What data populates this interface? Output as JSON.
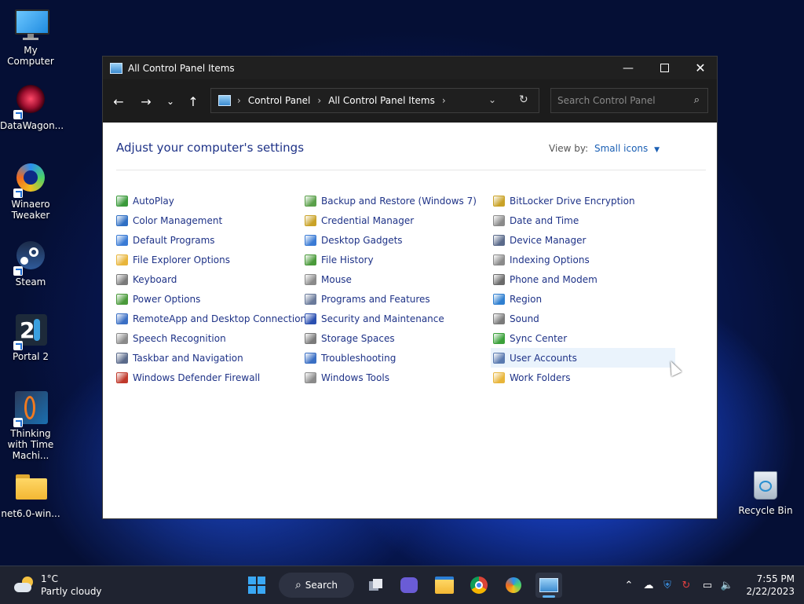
{
  "desktop": {
    "icons": [
      {
        "label": "My Computer"
      },
      {
        "label": "DataWagon..."
      },
      {
        "label": "Winaero Tweaker"
      },
      {
        "label": "Steam"
      },
      {
        "label": "Portal 2"
      },
      {
        "label": "Thinking with Time Machi..."
      },
      {
        "label": "net6.0-win..."
      }
    ],
    "recycle_bin": "Recycle Bin"
  },
  "window": {
    "title": "All Control Panel Items",
    "breadcrumb": [
      "Control Panel",
      "All Control Panel Items"
    ],
    "search_placeholder": "Search Control Panel",
    "heading": "Adjust your computer's settings",
    "view_by_label": "View by:",
    "view_by_value": "Small icons",
    "columns": [
      [
        {
          "label": "AutoPlay",
          "icon": "autoplay-icon",
          "color": "#3a9a3a"
        },
        {
          "label": "Color Management",
          "icon": "color-management-icon",
          "color": "#2f6fc4"
        },
        {
          "label": "Default Programs",
          "icon": "default-programs-icon",
          "color": "#3a7bd5"
        },
        {
          "label": "File Explorer Options",
          "icon": "folder-options-icon",
          "color": "#e8b53a"
        },
        {
          "label": "Keyboard",
          "icon": "keyboard-icon",
          "color": "#7a7a7a"
        },
        {
          "label": "Power Options",
          "icon": "power-options-icon",
          "color": "#4a9a3a"
        },
        {
          "label": "RemoteApp and Desktop Connections",
          "icon": "remoteapp-icon",
          "color": "#3a6fc4"
        },
        {
          "label": "Speech Recognition",
          "icon": "microphone-icon",
          "color": "#8a8a8a"
        },
        {
          "label": "Taskbar and Navigation",
          "icon": "taskbar-icon",
          "color": "#5a6a8a"
        },
        {
          "label": "Windows Defender Firewall",
          "icon": "firewall-icon",
          "color": "#c0392b"
        }
      ],
      [
        {
          "label": "Backup and Restore (Windows 7)",
          "icon": "backup-icon",
          "color": "#5aa04a"
        },
        {
          "label": "Credential Manager",
          "icon": "credential-icon",
          "color": "#c9a227"
        },
        {
          "label": "Desktop Gadgets",
          "icon": "gadgets-icon",
          "color": "#3a7bd5"
        },
        {
          "label": "File History",
          "icon": "file-history-icon",
          "color": "#4a9a3a"
        },
        {
          "label": "Mouse",
          "icon": "mouse-icon",
          "color": "#8a8a8a"
        },
        {
          "label": "Programs and Features",
          "icon": "programs-icon",
          "color": "#6a7a9a"
        },
        {
          "label": "Security and Maintenance",
          "icon": "flag-icon",
          "color": "#2a4fb0"
        },
        {
          "label": "Storage Spaces",
          "icon": "storage-icon",
          "color": "#7a7a7a"
        },
        {
          "label": "Troubleshooting",
          "icon": "troubleshooting-icon",
          "color": "#3a6fc4"
        },
        {
          "label": "Windows Tools",
          "icon": "tools-icon",
          "color": "#8a8a8a"
        }
      ],
      [
        {
          "label": "BitLocker Drive Encryption",
          "icon": "bitlocker-icon",
          "color": "#c9a227"
        },
        {
          "label": "Date and Time",
          "icon": "clock-icon",
          "color": "#8a8a8a"
        },
        {
          "label": "Device Manager",
          "icon": "device-manager-icon",
          "color": "#5a6a8a"
        },
        {
          "label": "Indexing Options",
          "icon": "indexing-icon",
          "color": "#8a8a8a"
        },
        {
          "label": "Phone and Modem",
          "icon": "phone-icon",
          "color": "#6a6a6a"
        },
        {
          "label": "Region",
          "icon": "globe-icon",
          "color": "#2f7fd0"
        },
        {
          "label": "Sound",
          "icon": "speaker-icon",
          "color": "#7a7a7a"
        },
        {
          "label": "Sync Center",
          "icon": "sync-icon",
          "color": "#3aa03a"
        },
        {
          "label": "User Accounts",
          "icon": "user-accounts-icon",
          "color": "#5a7ab0",
          "highlighted": true
        },
        {
          "label": "Work Folders",
          "icon": "work-folders-icon",
          "color": "#e8b53a"
        }
      ]
    ]
  },
  "taskbar": {
    "weather_temp": "1°C",
    "weather_desc": "Partly cloudy",
    "search_label": "Search",
    "time": "7:55 PM",
    "date": "2/22/2023"
  }
}
